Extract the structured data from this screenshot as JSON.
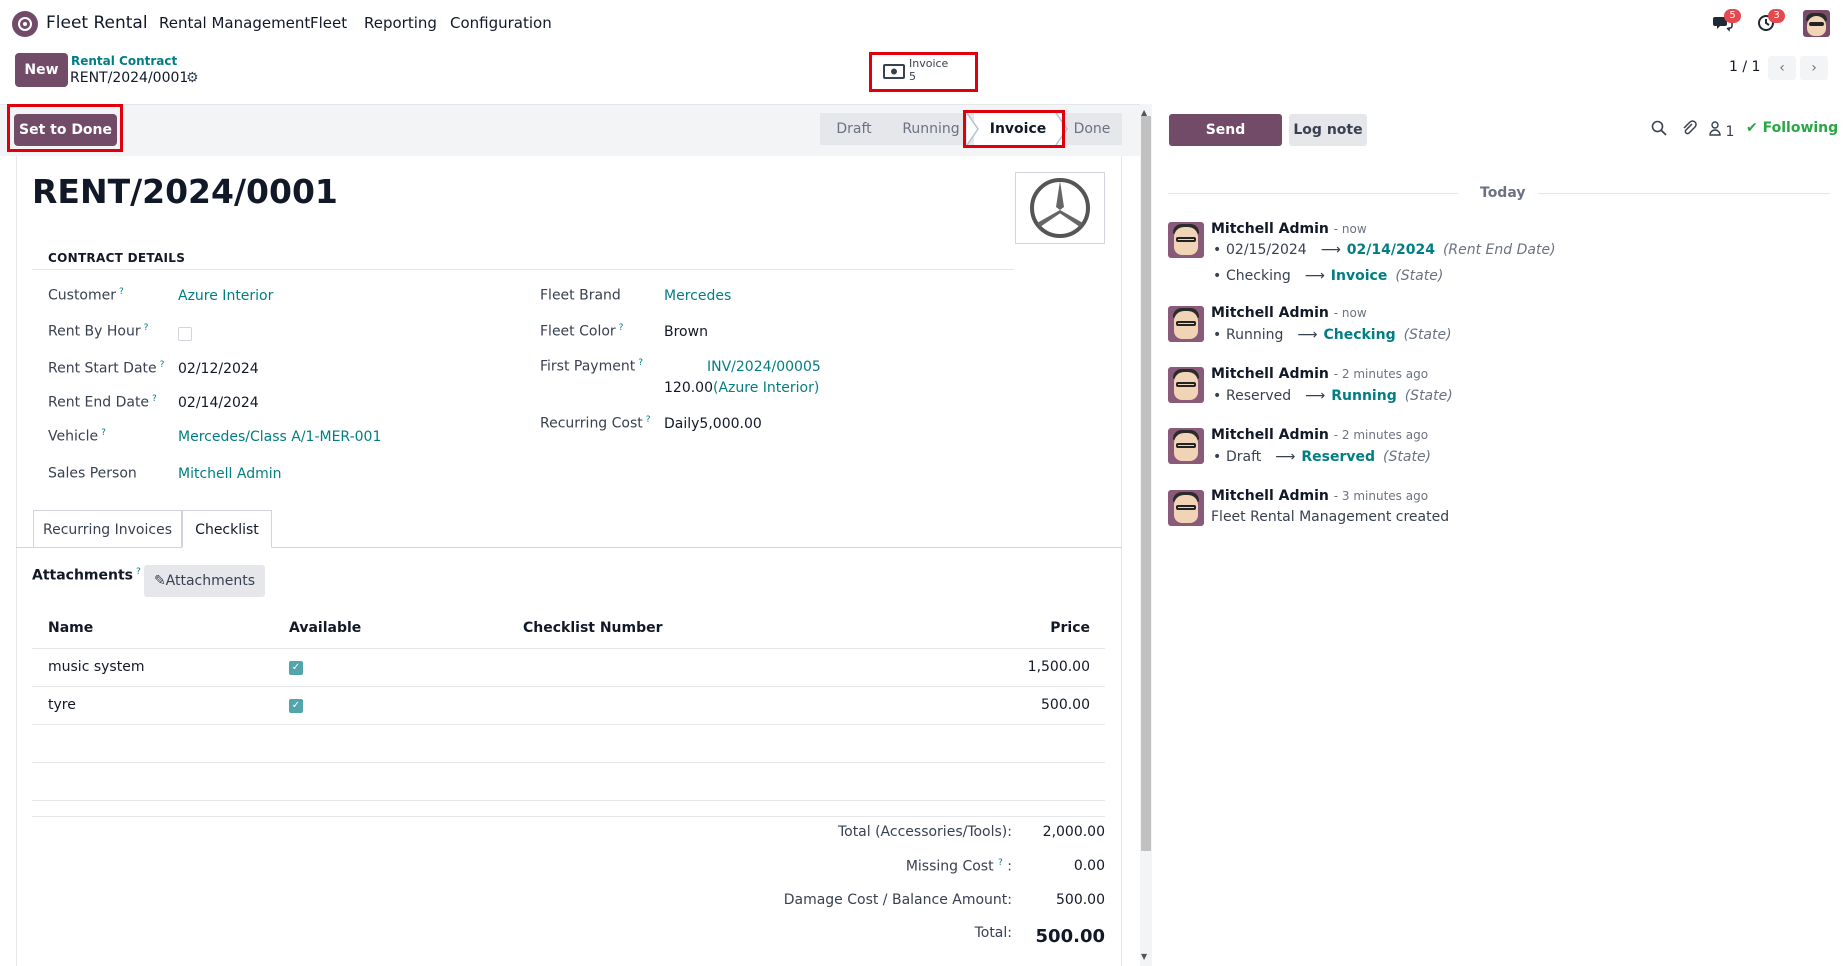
{
  "nav": {
    "app_name": "Fleet Rental",
    "menu": [
      "Rental Management",
      "Fleet",
      "Reporting",
      "Configuration"
    ],
    "messages_badge": "5",
    "activities_badge": "3"
  },
  "control": {
    "new_label": "New",
    "breadcrumb_parent": "Rental Contract",
    "breadcrumb_current": "RENT/2024/0001",
    "smart_button": {
      "label": "Invoice",
      "count": "5"
    },
    "pager": "1 / 1"
  },
  "statusbar": {
    "action_label": "Set to Done",
    "stages": [
      "Draft",
      "Running",
      "Invoice",
      "Done"
    ],
    "active_stage": "Invoice"
  },
  "form": {
    "title": "RENT/2024/0001",
    "section_title": "CONTRACT DETAILS",
    "left": [
      {
        "label": "Customer",
        "help": "?",
        "value": "Azure Interior"
      },
      {
        "label": "Rent By Hour",
        "help": "?",
        "value": ""
      },
      {
        "label": "Rent Start Date",
        "help": "?",
        "value": "02/12/2024"
      },
      {
        "label": "Rent End Date",
        "help": "?",
        "value": "02/14/2024"
      },
      {
        "label": "Vehicle",
        "help": "?",
        "value": "Mercedes/Class A/1-MER-001"
      },
      {
        "label": "Sales Person",
        "help": "",
        "value": "Mitchell Admin"
      }
    ],
    "right": [
      {
        "label": "Fleet Brand",
        "help": "",
        "value": "Mercedes"
      },
      {
        "label": "Fleet Color",
        "help": "?",
        "value": "Brown"
      },
      {
        "label": "First Payment",
        "help": "?",
        "value": "INV/2024/00005",
        "value2_amount": "120.00",
        "value2_partner": "(Azure Interior)"
      },
      {
        "label": "Recurring Cost",
        "help": "?",
        "value": "Daily5,000.00"
      }
    ],
    "tabs": [
      "Recurring Invoices",
      "Checklist"
    ],
    "active_tab": "Checklist",
    "attachments_label": "Attachments",
    "attachments_help": "?",
    "attachments_button": "Attachments",
    "table": {
      "columns": [
        "Name",
        "Available",
        "Checklist Number",
        "Price"
      ],
      "rows": [
        {
          "name": "music system",
          "available": true,
          "checklist_number": "",
          "price": "1,500.00"
        },
        {
          "name": "tyre",
          "available": true,
          "checklist_number": "",
          "price": "500.00"
        }
      ]
    },
    "totals": [
      {
        "label": "Total (Accessories/Tools):",
        "value": "2,000.00"
      },
      {
        "label": "Missing Cost",
        "help": "?",
        "suffix": ":",
        "value": "0.00"
      },
      {
        "label": "Damage Cost / Balance Amount:",
        "value": "500.00"
      },
      {
        "label": "Total:",
        "value": "500.00"
      }
    ]
  },
  "chatter": {
    "send_message": "Send message",
    "log_note": "Log note",
    "followers_count": "1",
    "following_label": "Following",
    "date_separator": "Today",
    "messages": [
      {
        "author": "Mitchell Admin",
        "time": "- now",
        "changes": [
          {
            "old": "02/15/2024",
            "new": "02/14/2024",
            "field": "(Rent End Date)"
          },
          {
            "old": "Checking",
            "new": "Invoice",
            "field": "(State)"
          }
        ]
      },
      {
        "author": "Mitchell Admin",
        "time": "- now",
        "changes": [
          {
            "old": "Running",
            "new": "Checking",
            "field": "(State)"
          }
        ]
      },
      {
        "author": "Mitchell Admin",
        "time": "- 2 minutes ago",
        "changes": [
          {
            "old": "Reserved",
            "new": "Running",
            "field": "(State)"
          }
        ]
      },
      {
        "author": "Mitchell Admin",
        "time": "- 2 minutes ago",
        "changes": [
          {
            "old": "Draft",
            "new": "Reserved",
            "field": "(State)"
          }
        ]
      },
      {
        "author": "Mitchell Admin",
        "time": "- 3 minutes ago",
        "body": "Fleet Rental Management created"
      }
    ]
  },
  "colors": {
    "brand": "#714b67",
    "link": "#017e84",
    "highlight": "#e0000c",
    "following": "#28a745"
  }
}
